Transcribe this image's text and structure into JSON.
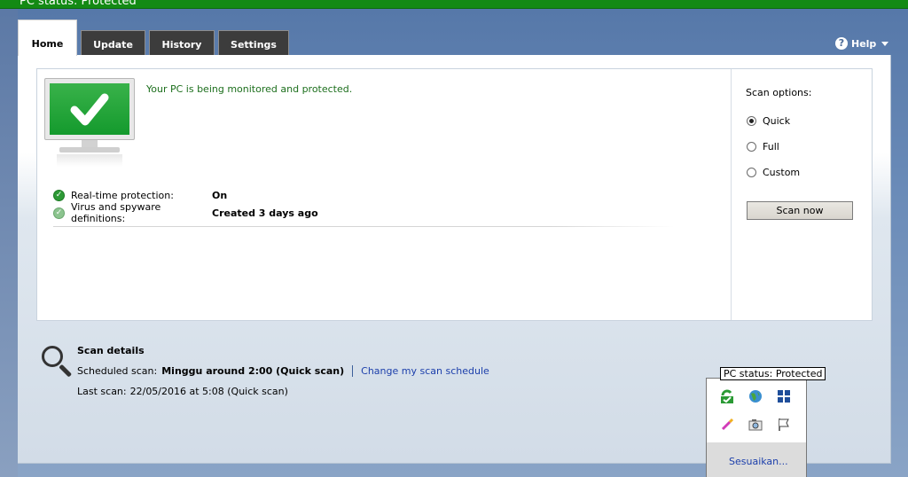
{
  "title_bar": {
    "text": "PC status: Protected"
  },
  "tabs": [
    {
      "label": "Home"
    },
    {
      "label": "Update"
    },
    {
      "label": "History"
    },
    {
      "label": "Settings"
    }
  ],
  "help": {
    "label": "Help"
  },
  "status": {
    "message": "Your PC is being monitored and protected.",
    "rows": [
      {
        "label": "Real-time protection:",
        "value": "On"
      },
      {
        "label": "Virus and spyware definitions:",
        "value": "Created 3 days ago"
      }
    ]
  },
  "scan_options": {
    "title": "Scan options:",
    "options": [
      {
        "label": "Quick",
        "selected": true
      },
      {
        "label": "Full",
        "selected": false
      },
      {
        "label": "Custom",
        "selected": false
      }
    ],
    "button_label": "Scan now"
  },
  "scan_details": {
    "title": "Scan details",
    "scheduled_label": "Scheduled scan:",
    "scheduled_value": "Minggu around 2:00 (Quick scan)",
    "change_link": "Change my scan schedule",
    "last_label": "Last scan:",
    "last_value": "22/05/2016 at 5:08 (Quick scan)"
  },
  "tray": {
    "tooltip": "PC status: Protected",
    "icons": [
      "security-shield-icon",
      "network-globe-icon",
      "windows-grid-icon",
      "paint-brush-icon",
      "camera-icon",
      "flag-icon"
    ],
    "customize_link": "Sesuaikan..."
  },
  "colors": {
    "protected_green": "#149a2d",
    "title_bar_green": "#138a14",
    "link_blue": "#1c3fab"
  }
}
